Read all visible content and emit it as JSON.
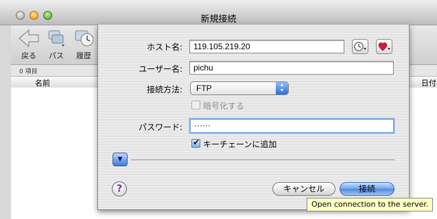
{
  "window": {
    "title": "新規接続"
  },
  "toolbar": {
    "back_label": "戻る",
    "path_label": "パス",
    "history_label": "履歴"
  },
  "status": {
    "item_count": "0 項目"
  },
  "columns": {
    "name": "名前",
    "date": "日付"
  },
  "dialog": {
    "host_label": "ホスト名:",
    "host_value": "119.105.219.20",
    "user_label": "ユーザー名:",
    "user_value": "pichu",
    "method_label": "接続方法:",
    "method_value": "FTP",
    "encrypt_label": "暗号化する",
    "password_label": "パスワード:",
    "password_value": "······",
    "keychain_label": "キーチェーンに追加",
    "keychain_checked": true,
    "encrypt_checked": false,
    "cancel_label": "キャンセル",
    "connect_label": "接続",
    "help_label": "?"
  },
  "tooltip": {
    "text": "Open connection to the server."
  },
  "colors": {
    "default_button": "#4d8ae1",
    "favorite_heart": "#d21c3c",
    "help_question": "#7a2aa3"
  }
}
